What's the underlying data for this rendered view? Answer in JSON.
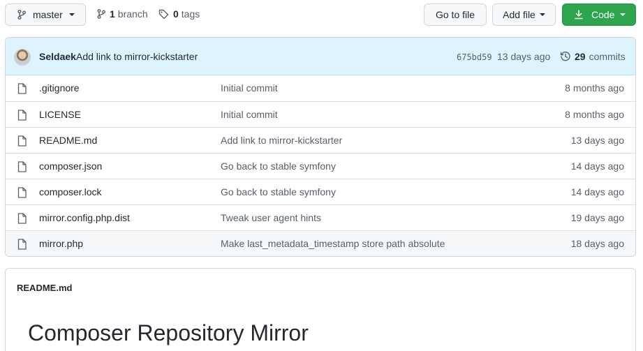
{
  "toolbar": {
    "branch_name": "master",
    "branch_count": "1",
    "branch_label": "branch",
    "tag_count": "0",
    "tag_label": "tags",
    "goto_file_label": "Go to file",
    "add_file_label": "Add file",
    "code_label": "Code"
  },
  "latest_commit": {
    "author": "Seldaek",
    "message": "Add link to mirror-kickstarter",
    "sha": "675bd59",
    "age": "13 days ago",
    "commit_count": "29",
    "commits_label": "commits"
  },
  "files": [
    {
      "name": ".gitignore",
      "message": "Initial commit",
      "age": "8 months ago"
    },
    {
      "name": "LICENSE",
      "message": "Initial commit",
      "age": "8 months ago"
    },
    {
      "name": "README.md",
      "message": "Add link to mirror-kickstarter",
      "age": "13 days ago"
    },
    {
      "name": "composer.json",
      "message": "Go back to stable symfony",
      "age": "14 days ago"
    },
    {
      "name": "composer.lock",
      "message": "Go back to stable symfony",
      "age": "14 days ago"
    },
    {
      "name": "mirror.config.php.dist",
      "message": "Tweak user agent hints",
      "age": "19 days ago"
    },
    {
      "name": "mirror.php",
      "message": "Make last_metadata_timestamp store path absolute",
      "age": "18 days ago"
    }
  ],
  "readme": {
    "filename": "README.md",
    "title": "Composer Repository Mirror"
  },
  "colors": {
    "accent_green": "#2da44e",
    "commit_bar_blue": "#ddf4ff"
  },
  "icons": [
    "git-branch-icon",
    "tag-icon",
    "download-icon",
    "history-icon",
    "file-icon"
  ]
}
